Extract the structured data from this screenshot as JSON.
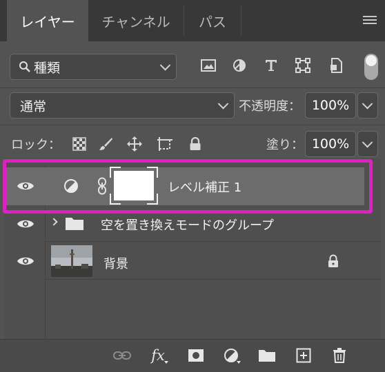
{
  "tabs": [
    {
      "label": "レイヤー",
      "active": true
    },
    {
      "label": "チャンネル",
      "active": false
    },
    {
      "label": "パス",
      "active": false
    }
  ],
  "filter": {
    "kind_label": "種類"
  },
  "blend": {
    "mode": "通常",
    "opacity_label": "不透明度：",
    "opacity_value": "100%"
  },
  "lock": {
    "label": "ロック：",
    "fill_label": "塗り：",
    "fill_value": "100%"
  },
  "layers": [
    {
      "name": "レベル補正 1",
      "type": "adjustment",
      "selected": true,
      "visible": true
    },
    {
      "name": "空を置き換えモードのグループ",
      "type": "group",
      "selected": false,
      "visible": true
    },
    {
      "name": "背景",
      "type": "image",
      "selected": false,
      "visible": true,
      "locked": true
    }
  ],
  "bottom": {
    "fx_label": "fx"
  },
  "colors": {
    "highlight": "#e020c0",
    "panel": "#535353",
    "tabbar": "#383838"
  }
}
